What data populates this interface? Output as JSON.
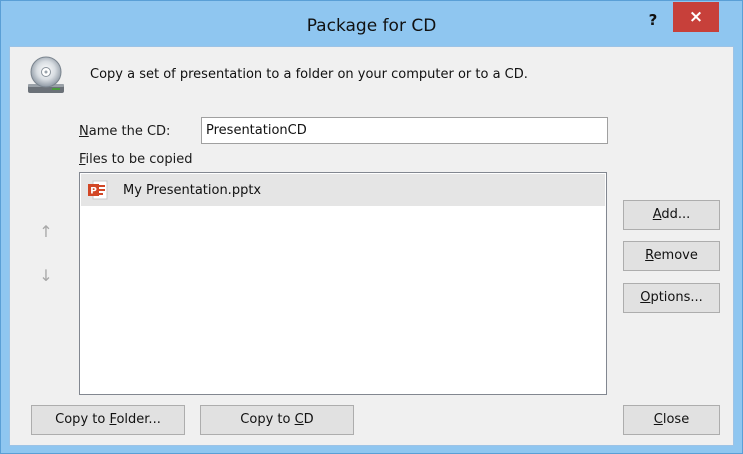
{
  "window": {
    "title": "Package for CD",
    "help_label": "?",
    "close_glyph": "×"
  },
  "description": "Copy a set of presentation to a folder on your computer or to a CD.",
  "name_field": {
    "label_prefix": "N",
    "label_rest": "ame the CD:",
    "value": "PresentationCD"
  },
  "files": {
    "label_prefix": "F",
    "label_rest": "iles to be copied",
    "items": [
      {
        "name": "My Presentation.pptx",
        "icon": "powerpoint-file-icon",
        "selected": true
      }
    ]
  },
  "reorder": {
    "up_glyph": "↑",
    "down_glyph": "↓"
  },
  "side_buttons": {
    "add": {
      "mnemonic": "A",
      "rest": "dd..."
    },
    "remove": {
      "mnemonic": "R",
      "rest": "emove"
    },
    "options": {
      "mnemonic": "O",
      "rest": "ptions..."
    }
  },
  "bottom_buttons": {
    "copy_folder": {
      "before": "Copy to ",
      "mnemonic": "F",
      "rest": "older..."
    },
    "copy_cd": {
      "before": "Copy to ",
      "mnemonic": "C",
      "rest": "D"
    },
    "close": {
      "mnemonic": "C",
      "rest": "lose"
    }
  },
  "colors": {
    "titlebar": "#8fc6f0",
    "close_button": "#c7403a",
    "client_background": "#f0f0f0",
    "selected_row": "#e5e5e5"
  }
}
